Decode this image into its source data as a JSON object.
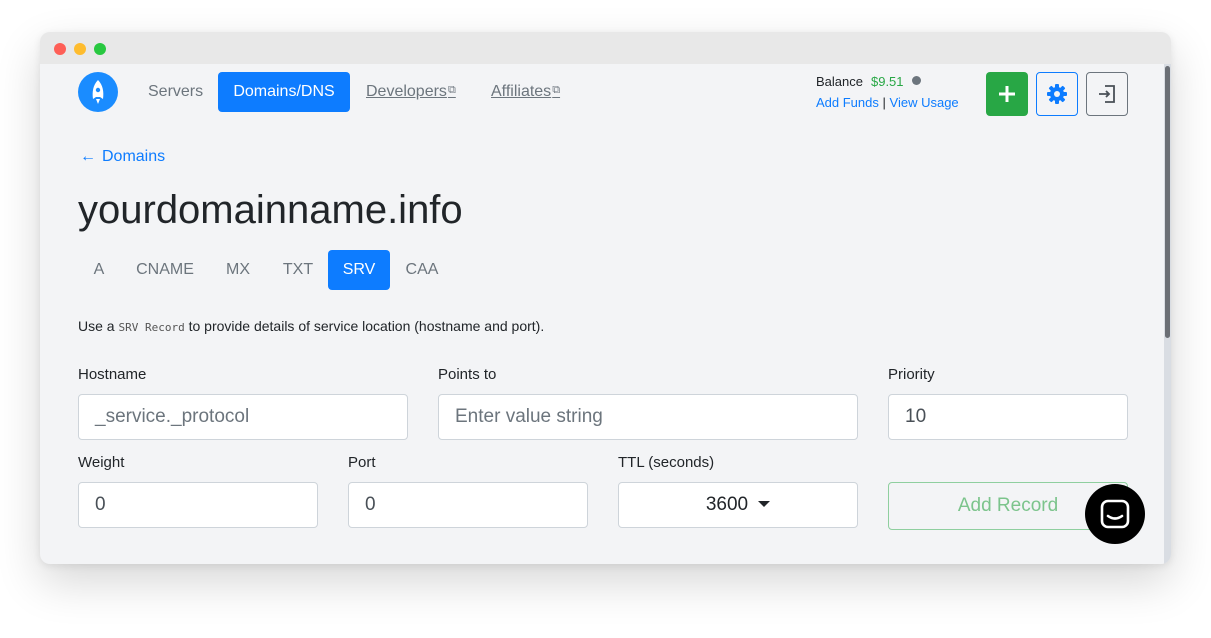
{
  "nav": {
    "servers": "Servers",
    "domains": "Domains/DNS",
    "developers": "Developers",
    "affiliates": "Affiliates",
    "external_icon": "external-link-icon"
  },
  "account": {
    "balance_label": "Balance",
    "balance_amount": "$9.51",
    "add_funds": "Add Funds",
    "separator": "|",
    "view_usage": "View Usage"
  },
  "actions": {
    "add_icon": "plus-icon",
    "settings_icon": "gear-icon",
    "logout_icon": "logout-icon"
  },
  "breadcrumb": {
    "back_label": "Domains",
    "arrow": "←"
  },
  "page": {
    "title": "yourdomainname.info"
  },
  "tabs": [
    {
      "label": "A",
      "active": false
    },
    {
      "label": "CNAME",
      "active": false
    },
    {
      "label": "MX",
      "active": false
    },
    {
      "label": "TXT",
      "active": false
    },
    {
      "label": "SRV",
      "active": true
    },
    {
      "label": "CAA",
      "active": false
    }
  ],
  "description": {
    "prefix": "Use a",
    "code": "SRV Record",
    "suffix": "to provide details of service location (hostname and port)."
  },
  "form": {
    "hostname": {
      "label": "Hostname",
      "placeholder": "_service._protocol"
    },
    "points_to": {
      "label": "Points to",
      "placeholder": "Enter value string"
    },
    "priority": {
      "label": "Priority",
      "value": "10"
    },
    "weight": {
      "label": "Weight",
      "value": "0"
    },
    "port": {
      "label": "Port",
      "value": "0"
    },
    "ttl": {
      "label": "TTL (seconds)",
      "value": "3600"
    },
    "submit": "Add Record"
  },
  "colors": {
    "primary": "#0d7cff",
    "success": "#28a745",
    "muted": "#6c757d"
  }
}
